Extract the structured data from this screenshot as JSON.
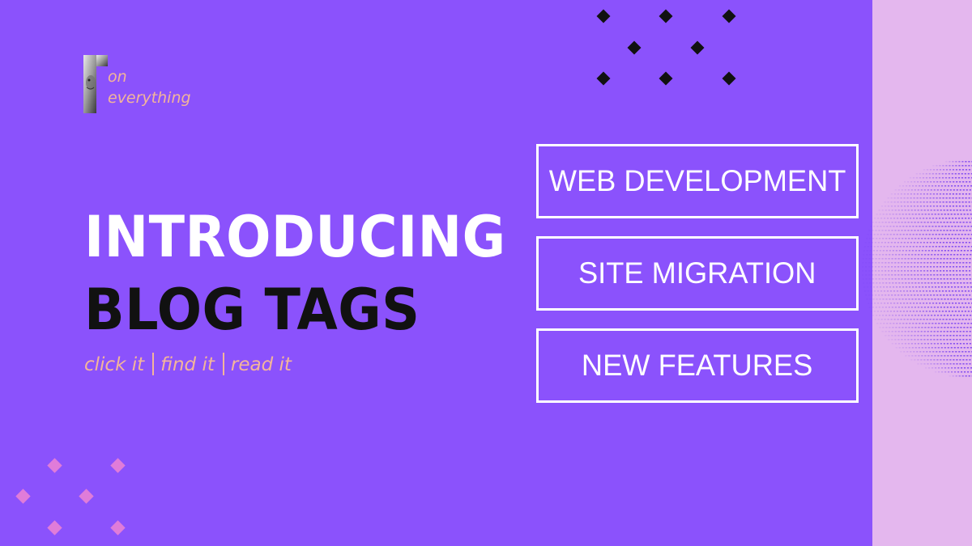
{
  "brand": {
    "line1": "on",
    "line2": "everything"
  },
  "headline": {
    "line1": "INTRODUCING",
    "line2": "BLOG TAGS"
  },
  "tagline": {
    "part1": "click it",
    "part2": "find it",
    "part3": "read it"
  },
  "tags": [
    "WEB DEVELOPMENT",
    "SITE MIGRATION",
    "NEW FEATURES"
  ],
  "colors": {
    "background": "#8b52fc",
    "side_strip": "#e4b7ee",
    "accent_text": "#f3b59a",
    "headline_primary": "#ffffff",
    "headline_secondary": "#111111",
    "diamond_dark": "#111111",
    "diamond_pink": "#e07cd9"
  },
  "icons": {
    "logo": "portrait-letter-r-logo",
    "pattern": "dotted-sphere"
  }
}
